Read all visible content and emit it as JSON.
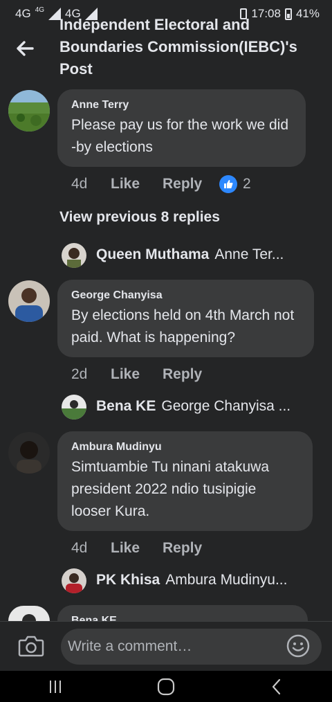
{
  "status_bar": {
    "network_1": "4G",
    "network_1_sup": "4G",
    "network_2": "4G",
    "time": "17:08",
    "battery": "41%"
  },
  "header": {
    "title": "Independent Electoral and Boundaries Commission(IEBC)'s Post",
    "back_icon": "arrow-left-icon"
  },
  "comments": [
    {
      "author": "Anne Terry",
      "text": "Please pay us for the work we did -by elections",
      "time": "4d",
      "like_label": "Like",
      "reply_label": "Reply",
      "like_count": "2"
    },
    {
      "author": "George Chanyisa",
      "text": "By elections held on 4th March not paid. What is happening?",
      "time": "2d",
      "like_label": "Like",
      "reply_label": "Reply"
    },
    {
      "author": "Ambura Mudinyu",
      "text": "Simtuambie Tu ninani atakuwa president 2022 ndio tusipigie looser Kura.",
      "time": "4d",
      "like_label": "Like",
      "reply_label": "Reply"
    },
    {
      "author": "Bena KE"
    }
  ],
  "view_previous": "View previous 8 replies",
  "reply_previews": [
    {
      "author": "Queen Muthama",
      "preview": "Anne Ter..."
    },
    {
      "author": "Bena KE",
      "preview": "George Chanyisa ..."
    },
    {
      "author": "PK Khisa",
      "preview": "Ambura Mudinyu..."
    }
  ],
  "composer": {
    "placeholder": "Write a comment…",
    "camera_icon": "camera-icon",
    "emoji_icon": "emoji-icon"
  },
  "colors": {
    "background": "#242526",
    "bubble": "#3a3b3c",
    "like_blue": "#2d88ff",
    "secondary_text": "#b0b3b8"
  }
}
